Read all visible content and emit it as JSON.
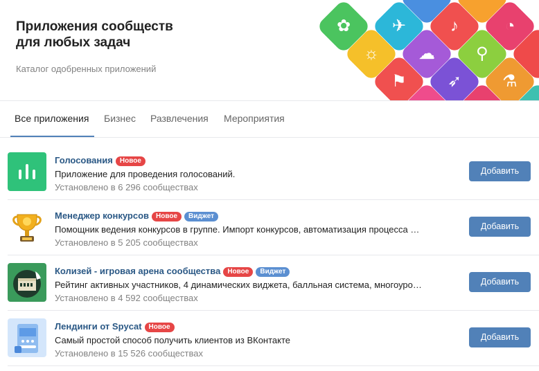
{
  "header": {
    "title_line1": "Приложения сообществ",
    "title_line2": "для любых задач",
    "subtitle": "Каталог одобренных приложений"
  },
  "tabs": [
    {
      "label": "Все приложения",
      "active": true
    },
    {
      "label": "Бизнес",
      "active": false
    },
    {
      "label": "Развлечения",
      "active": false
    },
    {
      "label": "Мероприятия",
      "active": false
    }
  ],
  "apps": [
    {
      "name": "Голосования",
      "badges": [
        "Новое"
      ],
      "description": "Приложение для проведения голосований.",
      "installs": "Установлено в 6 296 сообществах",
      "button": "Добавить",
      "icon": "bar-chart-icon"
    },
    {
      "name": "Менеджер конкурсов",
      "badges": [
        "Новое",
        "Виджет"
      ],
      "description": "Помощник ведения конкурсов в группе. Импорт конкурсов, автоматизация процесса …",
      "installs": "Установлено в 5 205 сообществах",
      "button": "Добавить",
      "icon": "trophy-icon"
    },
    {
      "name": "Колизей - игровая арена сообщества",
      "badges": [
        "Новое",
        "Виджет"
      ],
      "description": "Рейтинг активных участников, 4 динамических виджета, балльная система, многоуро…",
      "installs": "Установлено в 4 592 сообществах",
      "button": "Добавить",
      "icon": "colosseum-icon"
    },
    {
      "name": "Лендинги от Spycat",
      "badges": [
        "Новое"
      ],
      "description": "Самый простой способ получить клиентов из ВКонтакте",
      "installs": "Установлено в 15 526 сообществах",
      "button": "Добавить",
      "icon": "landing-page-icon"
    }
  ],
  "colors": {
    "accent": "#5181b8",
    "link": "#2a5885",
    "badge_new": "#e64646",
    "badge_widget": "#5b8fd1"
  }
}
